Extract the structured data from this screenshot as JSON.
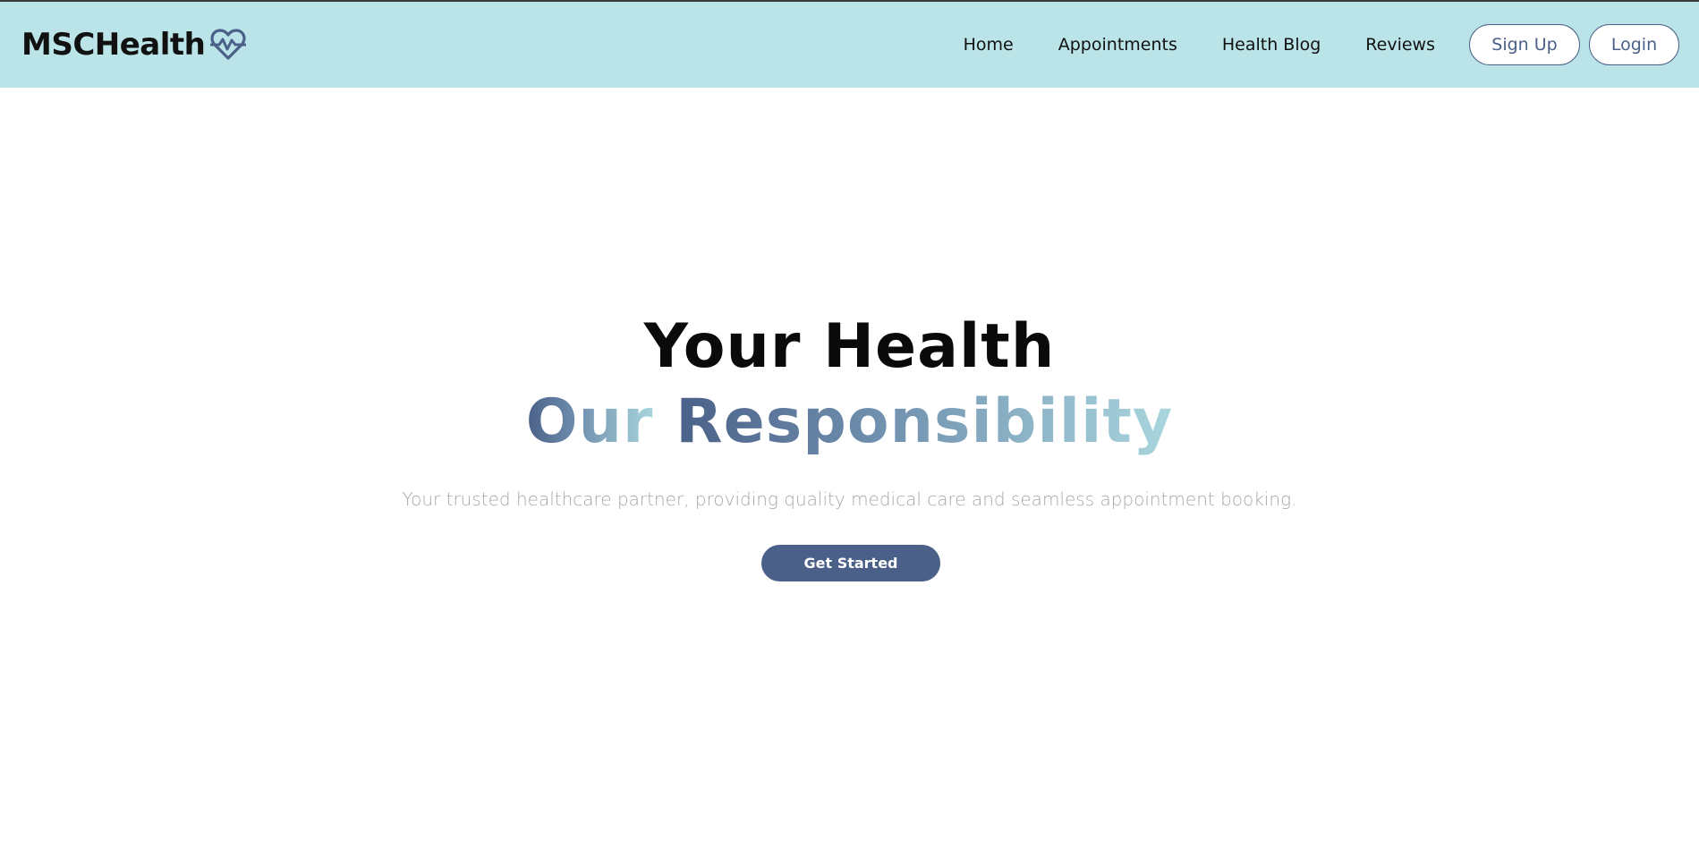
{
  "brand": {
    "name": "MSCHealth",
    "icon": "heart-pulse-icon"
  },
  "nav": {
    "links": [
      {
        "label": "Home"
      },
      {
        "label": "Appointments"
      },
      {
        "label": "Health Blog"
      },
      {
        "label": "Reviews"
      }
    ],
    "signup_label": "Sign Up",
    "login_label": "Login"
  },
  "hero": {
    "title_line1": "Your Health",
    "title_line2_part1": "Our",
    "title_line2_part2": "Responsibility",
    "subtitle": "Your trusted healthcare partner, providing quality medical care and seamless appointment booking.",
    "cta_label": "Get Started"
  },
  "colors": {
    "navbar_bg": "#bae4e8",
    "accent": "#4a6088",
    "gradient_end": "#a9d6de",
    "subtitle_text": "#a8a8a8"
  }
}
